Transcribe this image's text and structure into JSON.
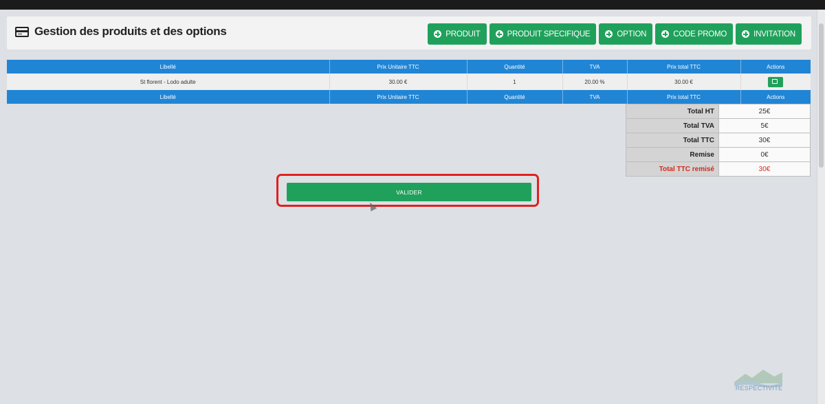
{
  "header": {
    "title": "Gestion des produits et des options",
    "title_icon": "credit-card-icon",
    "buttons": [
      {
        "label": "PRODUIT",
        "icon": "plus-circle-icon"
      },
      {
        "label": "PRODUIT SPECIFIQUE",
        "icon": "plus-circle-icon"
      },
      {
        "label": "OPTION",
        "icon": "plus-circle-icon"
      },
      {
        "label": "CODE PROMO",
        "icon": "plus-circle-icon"
      },
      {
        "label": "INVITATION",
        "icon": "plus-circle-icon"
      }
    ]
  },
  "products_table": {
    "headers": [
      "Libellé",
      "Prix Unitaire TTC",
      "Quantité",
      "TVA",
      "Prix total TTC",
      "Actions"
    ],
    "rows": [
      {
        "libelle": "St florent - Lodo adulte",
        "prix_unitaire": "30.00 €",
        "quantite": "1",
        "tva": "20.00 %",
        "prix_total": "30.00 €",
        "action_icon": "edit-icon"
      }
    ],
    "footer_headers": [
      "Libellé",
      "Prix Unitaire TTC",
      "Quantité",
      "TVA",
      "Prix total TTC",
      "Actions"
    ]
  },
  "totals": [
    {
      "label": "Total HT",
      "value": "25€"
    },
    {
      "label": "Total TVA",
      "value": "5€"
    },
    {
      "label": "Total TTC",
      "value": "30€"
    },
    {
      "label": "Remise",
      "value": "0€"
    },
    {
      "label": "Total TTC remisé",
      "value": "30€"
    }
  ],
  "valider_label": "VALIDER",
  "brand": {
    "text": "RESPECTIVITE"
  },
  "colors": {
    "accent_green": "#20a15b",
    "header_blue": "#2185d5",
    "highlight_red": "#e02020",
    "discount_red": "#d22b1b"
  }
}
